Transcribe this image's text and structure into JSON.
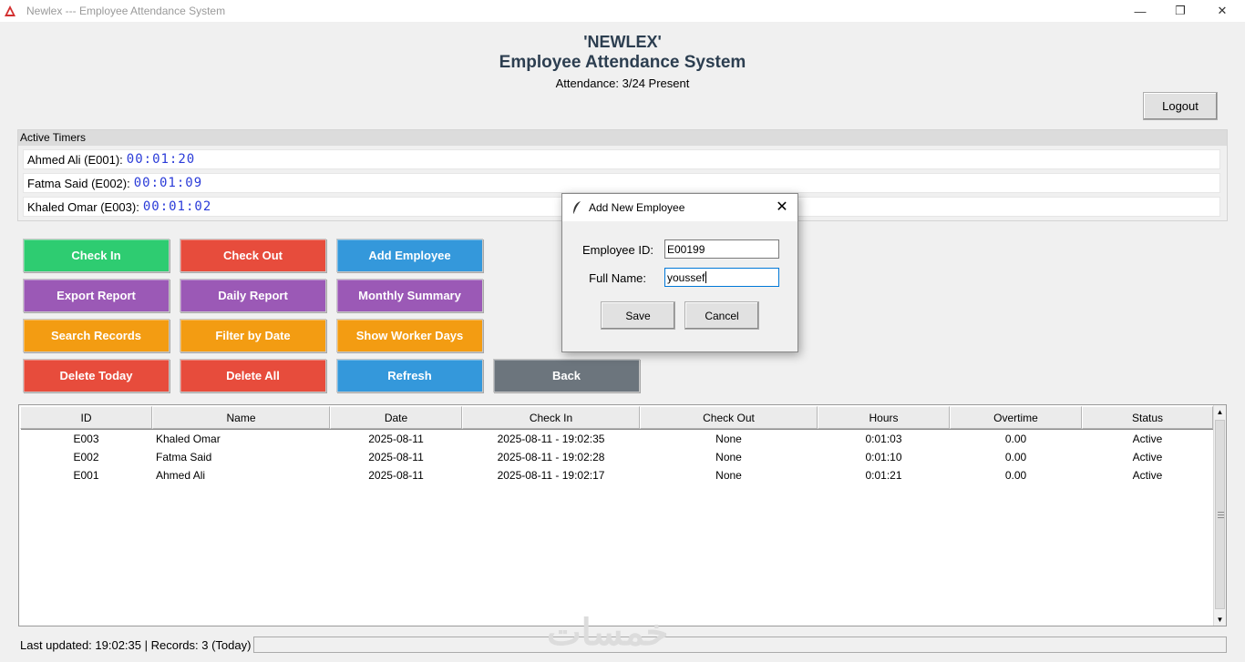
{
  "window": {
    "title": "Newlex --- Employee Attendance System",
    "controls": {
      "minimize": "—",
      "restore": "❐",
      "close": "✕"
    }
  },
  "header": {
    "company": "'NEWLEX'",
    "subtitle": "Employee Attendance System",
    "attendance": "Attendance: 3/24 Present",
    "logout_label": "Logout"
  },
  "timers": {
    "label": "Active Timers",
    "items": [
      {
        "name": "Ahmed Ali (E001):",
        "time": "00:01:20"
      },
      {
        "name": "Fatma Said (E002):",
        "time": "00:01:09"
      },
      {
        "name": "Khaled Omar (E003):",
        "time": "00:01:02"
      }
    ]
  },
  "actions": {
    "check_in": "Check In",
    "check_out": "Check Out",
    "add_employee": "Add Employee",
    "export_report": "Export Report",
    "daily_report": "Daily Report",
    "monthly_summary": "Monthly Summary",
    "search_records": "Search Records",
    "filter_by_date": "Filter by Date",
    "show_worker_days": "Show Worker Days",
    "delete_today": "Delete Today",
    "delete_all": "Delete All",
    "refresh": "Refresh",
    "back": "Back"
  },
  "colors": {
    "green": "#2ecc71",
    "red": "#e74c3c",
    "blue": "#3498db",
    "purple": "#9b59b6",
    "orange": "#f39c12",
    "gray": "#6c757d",
    "title_text": "#2c3e50",
    "timer_text": "#2a3bd8"
  },
  "table": {
    "columns": [
      "ID",
      "Name",
      "Date",
      "Check In",
      "Check Out",
      "Hours",
      "Overtime",
      "Status"
    ],
    "rows": [
      [
        "E003",
        "Khaled Omar",
        "2025-08-11",
        "2025-08-11 - 19:02:35",
        "None",
        "0:01:03",
        "0.00",
        "Active"
      ],
      [
        "E002",
        "Fatma Said",
        "2025-08-11",
        "2025-08-11 - 19:02:28",
        "None",
        "0:01:10",
        "0.00",
        "Active"
      ],
      [
        "E001",
        "Ahmed Ali",
        "2025-08-11",
        "2025-08-11 - 19:02:17",
        "None",
        "0:01:21",
        "0.00",
        "Active"
      ]
    ]
  },
  "status": {
    "text": "Last updated: 19:02:35 | Records: 3 (Today)"
  },
  "watermark": "خمسات",
  "dialog": {
    "title": "Add New Employee",
    "close": "✕",
    "id_label": "Employee ID:",
    "id_value": "E00199",
    "name_label": "Full Name:",
    "name_value": "youssef",
    "save_label": "Save",
    "cancel_label": "Cancel"
  }
}
